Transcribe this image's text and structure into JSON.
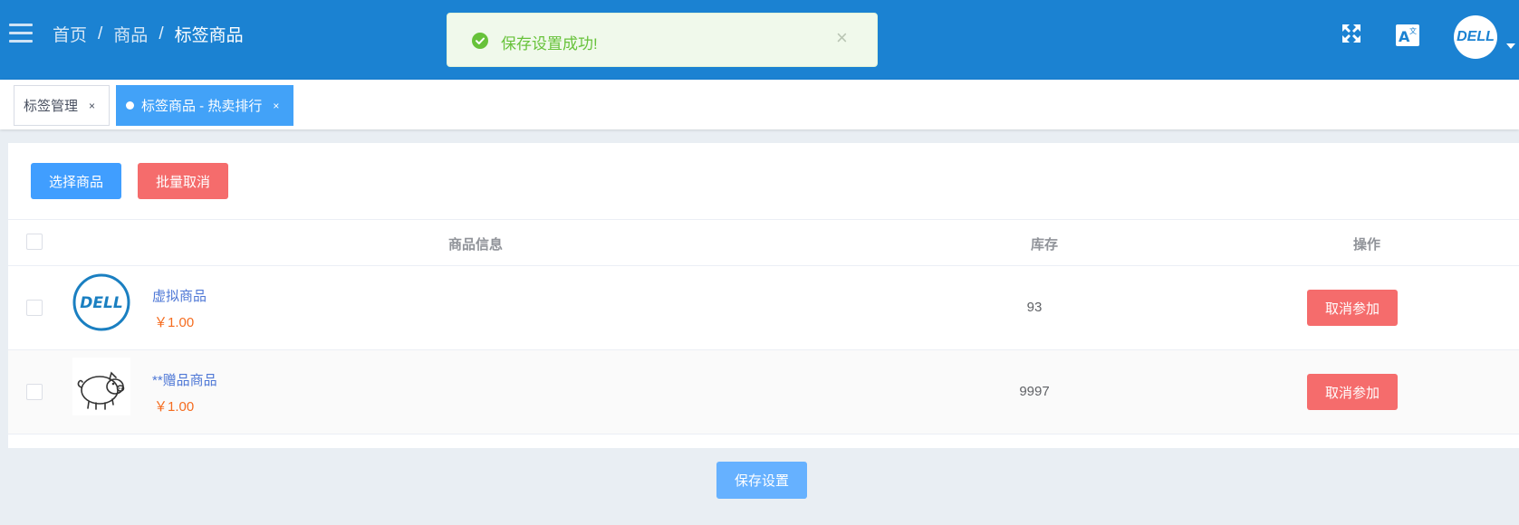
{
  "header": {
    "breadcrumb": [
      "首页",
      "商品",
      "标签商品"
    ],
    "breadcrumb_sep": "/",
    "avatar_text": "DELL",
    "bg_color": "#1b82d2"
  },
  "toast": {
    "message": "保存设置成功!",
    "close": "×",
    "type": "success"
  },
  "tags": [
    {
      "label": "标签管理",
      "close": "×",
      "active": false
    },
    {
      "label": "标签商品 - 热卖排行",
      "close": "×",
      "active": true
    }
  ],
  "toolbar": {
    "select_label": "选择商品",
    "batch_cancel_label": "批量取消"
  },
  "table": {
    "columns": [
      "商品信息",
      "库存",
      "操作"
    ],
    "rows": [
      {
        "name": "虚拟商品",
        "price": "￥1.00",
        "stock": "93",
        "action": "取消参加",
        "thumb": "dell-logo"
      },
      {
        "name": "**赠品商品",
        "price": "￥1.00",
        "stock": "9997",
        "action": "取消参加",
        "thumb": "pig-drawing"
      }
    ]
  },
  "footer": {
    "save_label": "保存设置"
  },
  "icons": {
    "menu": "hamburger-icon",
    "fullscreen": "fullscreen-icon",
    "translate": "translate-icon"
  }
}
